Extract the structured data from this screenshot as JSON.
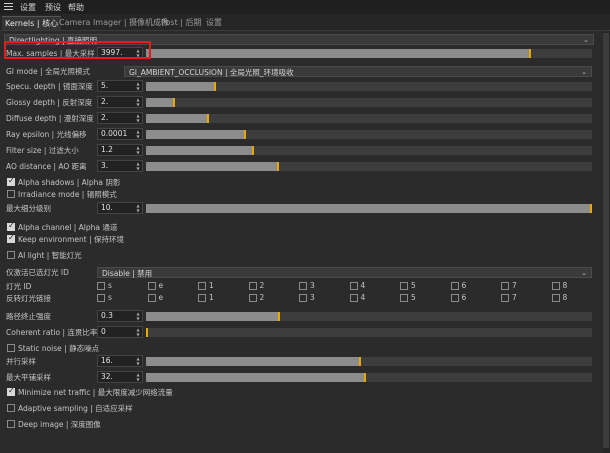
{
  "menubar": {
    "items": [
      "设置",
      "预设",
      "帮助"
    ]
  },
  "tabs": [
    "Kernels | 核心",
    "Camera Imager | 摄像机成像",
    "Post | 后期",
    "设置"
  ],
  "kernel_dropdown": "Directlighting | 直接照明",
  "rows": {
    "max_samples": {
      "label": "Max. samples | 最大采样",
      "value": "3997.",
      "fill": 0.86
    },
    "gi_mode": {
      "label": "GI mode | 全局光照模式",
      "value": "GI_AMBIENT_OCCLUSION | 全局光照_环境吸收"
    },
    "specu_depth": {
      "label": "Specu. depth | 镜面深度",
      "value": "5.",
      "fill": 0.154
    },
    "glossy_depth": {
      "label": "Glossy depth | 反射深度",
      "value": "2.",
      "fill": 0.062
    },
    "diffuse_depth": {
      "label": "Diffuse depth | 漫射深度",
      "value": "2.",
      "fill": 0.138
    },
    "ray_epsilon": {
      "label": "Ray epsilon | 光线偏移",
      "value": "0.0001",
      "fill": 0.221
    },
    "filter_size": {
      "label": "Filter size | 过滤大小",
      "value": "1.2",
      "fill": 0.239
    },
    "ao_distance": {
      "label": "AO distance | AO 距离",
      "value": "3.",
      "fill": 0.295
    },
    "alpha_shadows": {
      "label": "Alpha shadows | Alpha 阴影",
      "checked": true
    },
    "irradiance_mode": {
      "label": "Irradiance mode | 辐照模式",
      "checked": false
    },
    "max_subdiv": {
      "label": "最大细分级别",
      "value": "10.",
      "fill": 0.998
    },
    "alpha_channel": {
      "label": "Alpha channel | Alpha 通道",
      "checked": true
    },
    "keep_environment": {
      "label": "Keep environment | 保持环境",
      "checked": true
    },
    "ai_light": {
      "label": "AI light | 智能灯光",
      "checked": false
    },
    "light_id_behavior": {
      "label": "仅激活已选灯光 ID",
      "value": "Disable | 禁用"
    },
    "light_id": {
      "label": "灯光 ID",
      "options": [
        "s",
        "e",
        "1",
        "2",
        "3",
        "4",
        "5",
        "6",
        "7",
        "8"
      ]
    },
    "light_link_invert": {
      "label": "反转灯光链接",
      "options": [
        "s",
        "e",
        "1",
        "2",
        "3",
        "4",
        "5",
        "6",
        "7",
        "8"
      ]
    },
    "path_term_power": {
      "label": "路径终止强度",
      "value": "0.3",
      "fill": 0.298
    },
    "coherent_ratio": {
      "label": "Coherent ratio | 连贯比率",
      "value": "0",
      "fill": 0.0
    },
    "static_noise": {
      "label": "Static noise | 静态噪点",
      "checked": false
    },
    "parallel_samples": {
      "label": "并行采样",
      "value": "16.",
      "fill": 0.48
    },
    "max_tile_samples": {
      "label": "最大平铺采样",
      "value": "32.",
      "fill": 0.49
    },
    "minimize_net_traffic": {
      "label": "Minimize net traffic | 最大限度减少网络流量",
      "checked": true
    },
    "adaptive_sampling": {
      "label": "Adaptive sampling | 自适应采样",
      "checked": false
    },
    "deep_image": {
      "label": "Deep image | 深度图像",
      "checked": false
    }
  },
  "colors": {
    "slider_fill": "#8c8c8c",
    "slider_handle": "#e8a800",
    "highlight_border": "#e01e1e"
  }
}
